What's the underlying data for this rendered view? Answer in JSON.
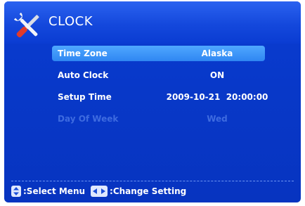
{
  "header": {
    "title": "CLOCK",
    "icon": "tools-icon"
  },
  "menu": {
    "items": [
      {
        "label": "Time Zone",
        "value": "Alaska",
        "state": "selected"
      },
      {
        "label": "Auto Clock",
        "value": "ON",
        "state": "normal"
      },
      {
        "label": "Setup Time",
        "value": "2009-10-21  20:00:00",
        "state": "normal"
      },
      {
        "label": "Day Of Week",
        "value": "Wed",
        "state": "disabled"
      }
    ]
  },
  "footer": {
    "select_hint": ":Select Menu",
    "change_hint": ":Change Setting",
    "select_icon": "up-down-arrows-icon",
    "change_icon": "left-right-arrows-icon"
  },
  "colors": {
    "background": "#0838c8",
    "highlight": "#3a93f7",
    "disabled_text": "#3e6be0"
  }
}
